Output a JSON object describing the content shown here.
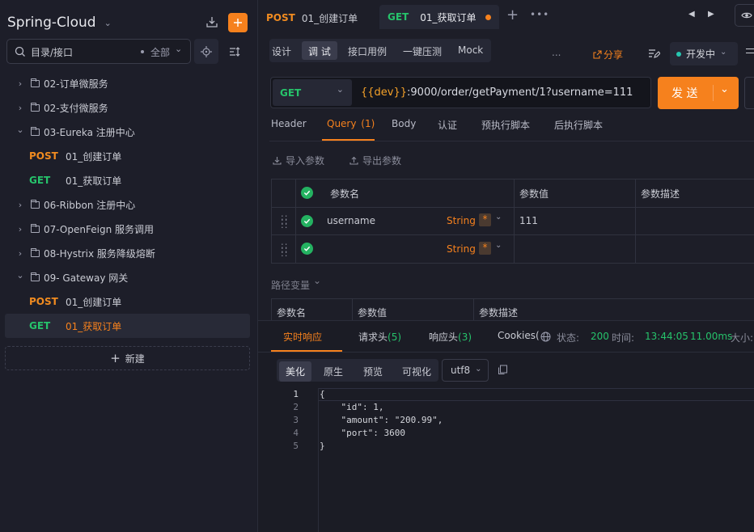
{
  "sidebar": {
    "project_title": "Spring-Cloud",
    "search_placeholder": "目录/接口",
    "filter_label": "全部",
    "tree": [
      {
        "type": "folder",
        "label": "02-订单微服务",
        "expanded": false
      },
      {
        "type": "folder",
        "label": "02-支付微服务",
        "expanded": false
      },
      {
        "type": "folder",
        "label": "03-Eureka 注册中心",
        "expanded": true
      },
      {
        "type": "request",
        "method": "POST",
        "label": "01_创建订单"
      },
      {
        "type": "request",
        "method": "GET",
        "label": "01_获取订单"
      },
      {
        "type": "folder",
        "label": "06-Ribbon 注册中心",
        "expanded": false
      },
      {
        "type": "folder",
        "label": "07-OpenFeign 服务调用",
        "expanded": false
      },
      {
        "type": "folder",
        "label": "08-Hystrix 服务降级熔断",
        "expanded": false
      },
      {
        "type": "folder",
        "label": "09- Gateway 网关",
        "expanded": true
      },
      {
        "type": "request",
        "method": "POST",
        "label": "01_创建订单"
      },
      {
        "type": "request",
        "method": "GET",
        "label": "01_获取订单",
        "selected": true
      }
    ],
    "new_label": "新建"
  },
  "tabs": [
    {
      "method": "POST",
      "label": "01_创建订单"
    },
    {
      "method": "GET",
      "label": "01_获取订单",
      "active": true,
      "unsaved": true
    }
  ],
  "modes": [
    "设计",
    "调 试",
    "接口用例",
    "一键压测",
    "Mock"
  ],
  "active_mode": "调 试",
  "more_label": "...",
  "share_label": "分享",
  "environment": "开发中",
  "request": {
    "method": "GET",
    "url_var": "{{dev}}",
    "url_rest": ":9000/order/getPayment/1?username=111",
    "send_label": "发 送"
  },
  "req_tabs": {
    "header": "Header",
    "query": "Query",
    "query_count": "(1)",
    "body": "Body",
    "auth": "认证",
    "pre_script": "预执行脚本",
    "post_script": "后执行脚本"
  },
  "import_label": "导入参数",
  "export_label": "导出参数",
  "params_table": {
    "headers": [
      "参数名",
      "参数值",
      "参数描述"
    ],
    "rows": [
      {
        "name": "username",
        "type": "String",
        "required": "*",
        "value": "111",
        "desc": ""
      },
      {
        "name": "",
        "type": "String",
        "required": "*",
        "value": "",
        "desc": ""
      }
    ]
  },
  "path_vars": {
    "title": "路径变量",
    "headers": [
      "参数名",
      "参数值",
      "参数描述"
    ]
  },
  "response": {
    "tabs": {
      "realtime": "实时响应",
      "req_headers": "请求头",
      "req_headers_count": "(5)",
      "res_headers": "响应头",
      "res_headers_count": "(3)",
      "cookies": "Cookies("
    },
    "status_label": "状态:",
    "status": "200",
    "time_label": "时间:",
    "time": "13:44:05",
    "duration": "11.00ms",
    "size_label": "大小:",
    "view_modes": [
      "美化",
      "原生",
      "预览",
      "可视化"
    ],
    "active_view": "美化",
    "encoding": "utf8",
    "body_lines": [
      {
        "n": "1",
        "text": "{"
      },
      {
        "n": "2",
        "text": "    \"id\": 1,"
      },
      {
        "n": "3",
        "text": "    \"amount\": \"200.99\","
      },
      {
        "n": "4",
        "text": "    \"port\": 3600"
      },
      {
        "n": "5",
        "text": "}"
      }
    ]
  },
  "colors": {
    "accent": "#f6811d",
    "get": "#26c36b",
    "post": "#f08b20",
    "bg": "#1b1c25"
  }
}
